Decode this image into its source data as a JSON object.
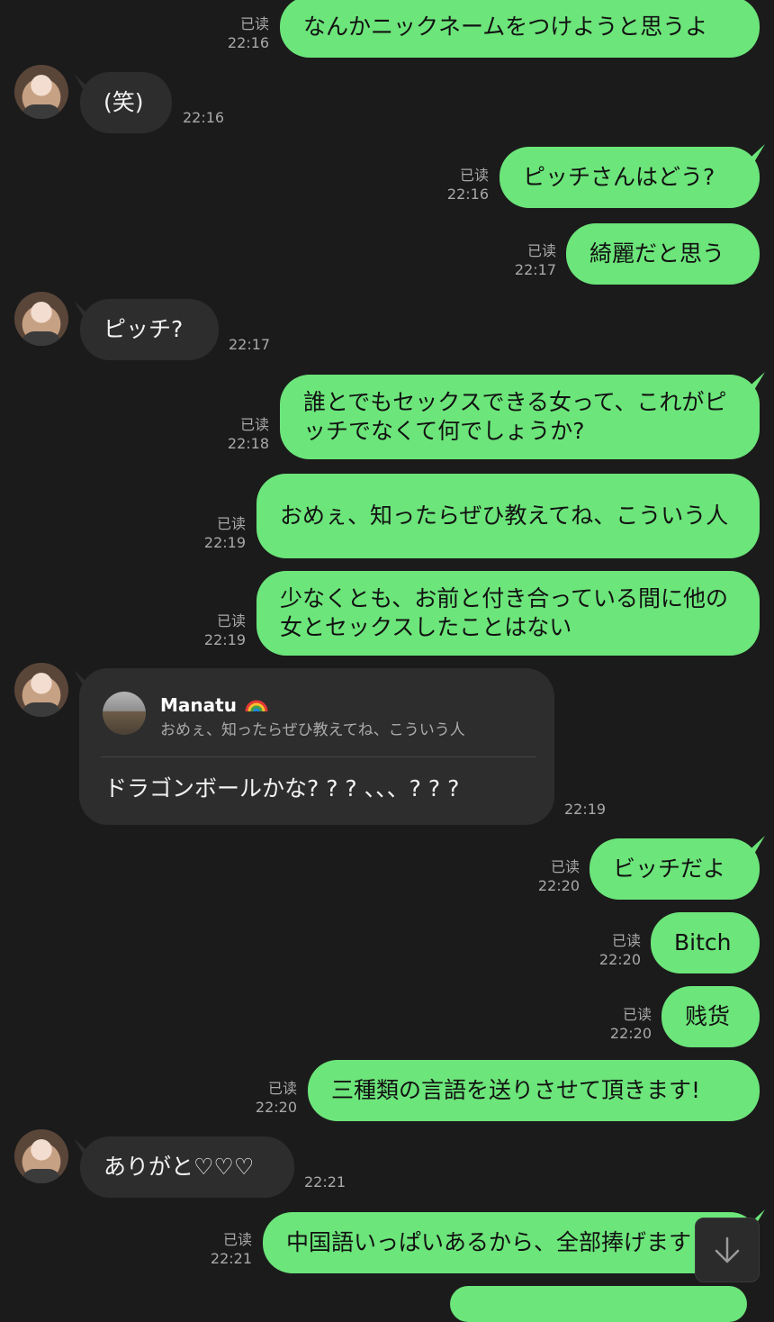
{
  "messages": [
    {
      "dir": "out",
      "text": "なんかニックネームをつけようと思うよ",
      "read": "已读",
      "time": "22:16"
    },
    {
      "dir": "in",
      "text": "(笑)",
      "time": "22:16"
    },
    {
      "dir": "out",
      "text": "ピッチさんはどう?",
      "read": "已读",
      "time": "22:16"
    },
    {
      "dir": "out",
      "text": "綺麗だと思う",
      "read": "已读",
      "time": "22:17"
    },
    {
      "dir": "in",
      "text": "ピッチ?",
      "time": "22:17"
    },
    {
      "dir": "out",
      "text": "誰とでもセックスできる女って、これがピッチでなくて何でしょうか?",
      "read": "已读",
      "time": "22:18"
    },
    {
      "dir": "out",
      "text": "おめぇ、知ったらぜひ教えてね、こういう人",
      "read": "已读",
      "time": "22:19"
    },
    {
      "dir": "out",
      "text": "少なくとも、お前と付き合っている間に他の女とセックスしたことはない",
      "read": "已读",
      "time": "22:19"
    },
    {
      "dir": "in",
      "reply_name": "Manatu",
      "reply_quote": "おめぇ、知ったらぜひ教えてね、こういう人",
      "text": "ドラゴンボールかな? ? ? 、、、? ? ?",
      "time": "22:19"
    },
    {
      "dir": "out",
      "text": "ビッチだよ",
      "read": "已读",
      "time": "22:20"
    },
    {
      "dir": "out",
      "text": "Bitch",
      "read": "已读",
      "time": "22:20"
    },
    {
      "dir": "out",
      "text": "贱货",
      "read": "已读",
      "time": "22:20"
    },
    {
      "dir": "out",
      "text": "三種類の言語を送りさせて頂きます!",
      "read": "已读",
      "time": "22:20"
    },
    {
      "dir": "in",
      "text": "ありがと♡♡♡",
      "time": "22:21"
    },
    {
      "dir": "out",
      "text": "中国語いっぱいあるから、全部捧げます",
      "read": "已读",
      "time": "22:21"
    }
  ],
  "icons": {
    "scroll_down": "arrow-down-icon",
    "avatar": "contact-avatar",
    "rainbow": "rainbow-emoji"
  },
  "colors": {
    "background": "#1b1b1b",
    "outgoing": "#6ce57a",
    "incoming": "#2d2d2d"
  }
}
